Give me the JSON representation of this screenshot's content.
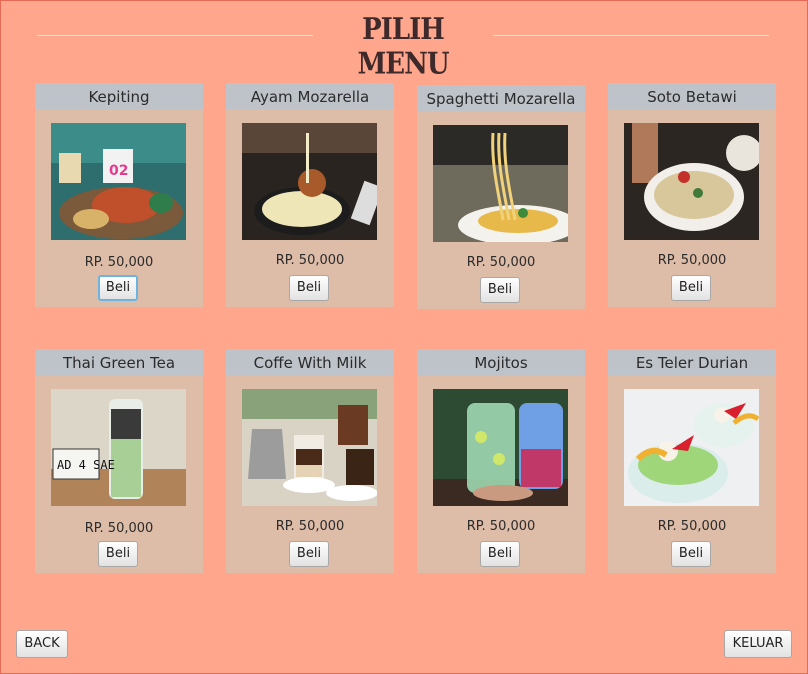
{
  "page": {
    "title": "PILIH MENU"
  },
  "menu": [
    {
      "name": "Kepiting",
      "price": "RP. 50,000",
      "button": "Beli"
    },
    {
      "name": "Ayam Mozarella",
      "price": "RP. 50,000",
      "button": "Beli"
    },
    {
      "name": "Spaghetti Mozarella",
      "price": "RP. 50,000",
      "button": "Beli"
    },
    {
      "name": "Soto Betawi",
      "price": "RP. 50,000",
      "button": "Beli"
    },
    {
      "name": "Thai Green Tea",
      "price": "RP. 50,000",
      "button": "Beli"
    },
    {
      "name": "Coffe With Milk",
      "price": "RP. 50,000",
      "button": "Beli"
    },
    {
      "name": "Mojitos",
      "price": "RP. 50,000",
      "button": "Beli"
    },
    {
      "name": "Es Teler Durian",
      "price": "RP. 50,000",
      "button": "Beli"
    }
  ],
  "footer": {
    "back_label": "BACK",
    "exit_label": "KELUAR"
  },
  "colors": {
    "background": "#FFA68C",
    "card": "#DDBCA8",
    "card_header": "#BEC3C9"
  }
}
